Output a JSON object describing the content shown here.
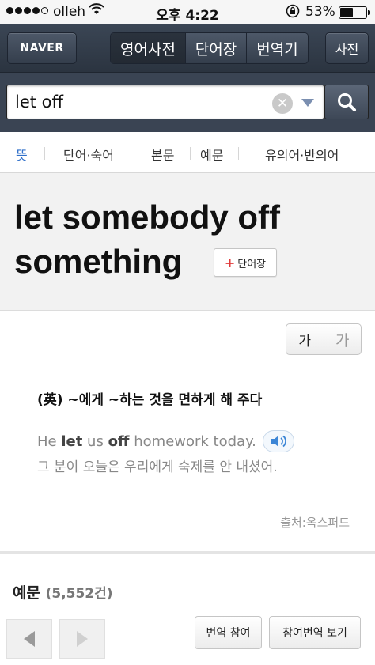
{
  "status_bar": {
    "carrier": "olleh",
    "time": "오후 4:22",
    "battery_pct": "53%",
    "battery_level": 0.53
  },
  "navbar": {
    "logo": "NAVER",
    "segments": [
      {
        "label": "영어사전",
        "active": true
      },
      {
        "label": "단어장",
        "active": false
      },
      {
        "label": "번역기",
        "active": false
      }
    ],
    "dict_button": "사전"
  },
  "search": {
    "query": "let off"
  },
  "tabs": [
    {
      "label": "뜻",
      "active": true
    },
    {
      "label": "단어·숙어"
    },
    {
      "label": "본문"
    },
    {
      "label": "예문"
    },
    {
      "label": "유의어·반의어"
    }
  ],
  "headword": {
    "text": "let somebody off something",
    "wordbook_label": "단어장"
  },
  "font_size": {
    "small": "가",
    "large": "가"
  },
  "definition": {
    "meaning": "(英) ~에게 ~하는 것을 면하게 해 주다",
    "example_en_parts": [
      "He ",
      "let",
      " us ",
      "off",
      " homework today."
    ],
    "example_ko": "그 분이 오늘은 우리에게 숙제를 안 내셨어.",
    "source": "출처:옥스퍼드"
  },
  "examples": {
    "title": "예문",
    "count": "(5,552건)",
    "translate_join": "번역 참여",
    "view_translations": "참여번역 보기"
  },
  "icons": {
    "wifi": "wifi-icon",
    "lock": "rotation-lock-icon",
    "search": "magnifier-icon",
    "clear": "clear-icon",
    "dropdown": "dropdown-icon",
    "speaker": "speaker-icon",
    "prev": "prev-arrow-icon",
    "next": "next-arrow-icon"
  },
  "colors": {
    "accent_blue": "#2f6fc9",
    "nav_bg": "#333c49",
    "plus_red": "#e03a3a"
  }
}
